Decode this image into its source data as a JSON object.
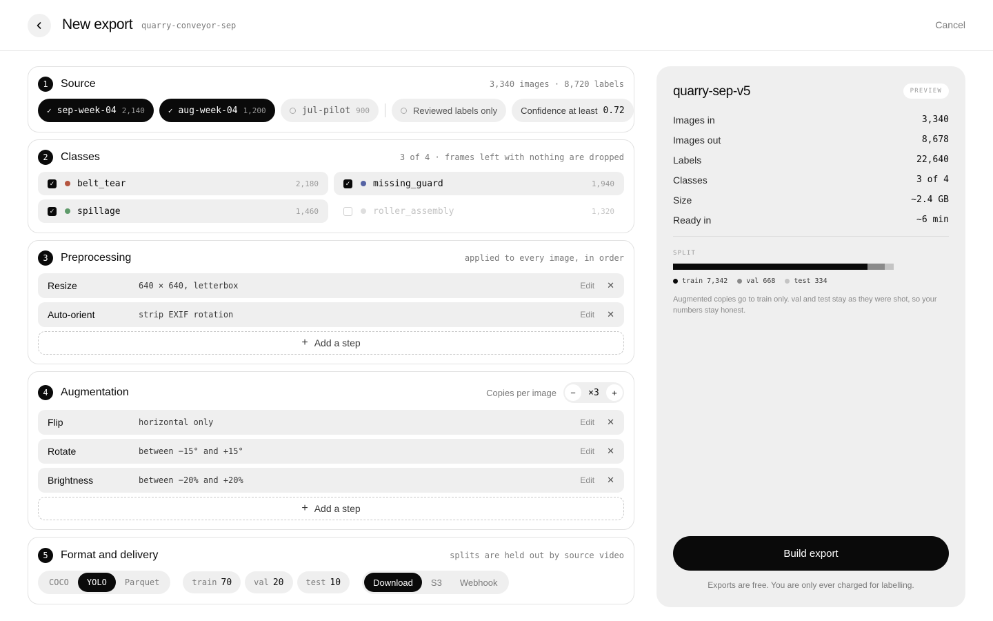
{
  "header": {
    "title": "New export",
    "project": "quarry-conveyor-sep",
    "cancel_label": "Cancel",
    "back_icon": "chevron-left-icon"
  },
  "source": {
    "step": "1",
    "title": "Source",
    "summary": "3,340 images · 8,720 labels",
    "batches": [
      {
        "name": "sep-week-04",
        "count": "2,140",
        "selected": true
      },
      {
        "name": "aug-week-04",
        "count": "1,200",
        "selected": true
      },
      {
        "name": "jul-pilot",
        "count": "900",
        "selected": false
      }
    ],
    "filters": {
      "reviewed_label": "Reviewed labels only",
      "confidence_label": "Confidence at least",
      "confidence_value": "0.72"
    }
  },
  "classes": {
    "step": "2",
    "title": "Classes",
    "note": "3 of 4 · frames left with nothing are dropped",
    "items": [
      {
        "name": "belt_tear",
        "count": "2,180",
        "checked": true,
        "color": "#b5553f"
      },
      {
        "name": "missing_guard",
        "count": "1,940",
        "checked": true,
        "color": "#5563a4"
      },
      {
        "name": "spillage",
        "count": "1,460",
        "checked": true,
        "color": "#5e9a6a"
      },
      {
        "name": "roller_assembly",
        "count": "1,320",
        "checked": false,
        "color": "#d6d6d6"
      }
    ]
  },
  "preprocessing": {
    "step": "3",
    "title": "Preprocessing",
    "note": "applied to every image, in order",
    "steps": [
      {
        "name": "Resize",
        "desc": "640 × 640, letterbox"
      },
      {
        "name": "Auto-orient",
        "desc": "strip EXIF rotation"
      }
    ],
    "edit_label": "Edit",
    "remove_glyph": "✕",
    "add_label": "Add a step"
  },
  "augmentation": {
    "step": "4",
    "title": "Augmentation",
    "copies_label": "Copies per image",
    "copies_value": "×3",
    "steps": [
      {
        "name": "Flip",
        "desc": "horizontal only"
      },
      {
        "name": "Rotate",
        "desc": "between −15° and +15°"
      },
      {
        "name": "Brightness",
        "desc": "between −20% and +20%"
      }
    ],
    "edit_label": "Edit",
    "remove_glyph": "✕",
    "add_label": "Add a step"
  },
  "format": {
    "step": "5",
    "title": "Format and delivery",
    "note": "splits are held out by source video",
    "formats": [
      {
        "label": "COCO",
        "selected": false
      },
      {
        "label": "YOLO",
        "selected": true
      },
      {
        "label": "Parquet",
        "selected": false
      }
    ],
    "splits": [
      {
        "label": "train",
        "value": "70"
      },
      {
        "label": "val",
        "value": "20"
      },
      {
        "label": "test",
        "value": "10"
      }
    ],
    "delivery": [
      {
        "label": "Download",
        "selected": true
      },
      {
        "label": "S3",
        "selected": false
      },
      {
        "label": "Webhook",
        "selected": false
      }
    ]
  },
  "preview": {
    "name": "quarry-sep-v5",
    "badge": "PREVIEW",
    "stats": [
      {
        "label": "Images in",
        "value": "3,340"
      },
      {
        "label": "Images out",
        "value": "8,678"
      },
      {
        "label": "Labels",
        "value": "22,640"
      },
      {
        "label": "Classes",
        "value": "3 of 4"
      },
      {
        "label": "Size",
        "value": "~2.4 GB"
      },
      {
        "label": "Ready in",
        "value": "~6 min"
      }
    ],
    "split_heading": "SPLIT",
    "split": [
      {
        "label": "train",
        "count": "7,342",
        "n": 7342,
        "color": "#0a0a0a"
      },
      {
        "label": "val",
        "count": "668",
        "n": 668,
        "color": "#8a8a8a"
      },
      {
        "label": "test",
        "count": "334",
        "n": 334,
        "color": "#c4c4c4"
      }
    ],
    "split_fill": 0.75,
    "note": "Augmented copies go to train only. val and test stay as they were shot, so your numbers stay honest.",
    "build_label": "Build export",
    "build_note": "Exports are free. You are only ever charged for labelling."
  }
}
